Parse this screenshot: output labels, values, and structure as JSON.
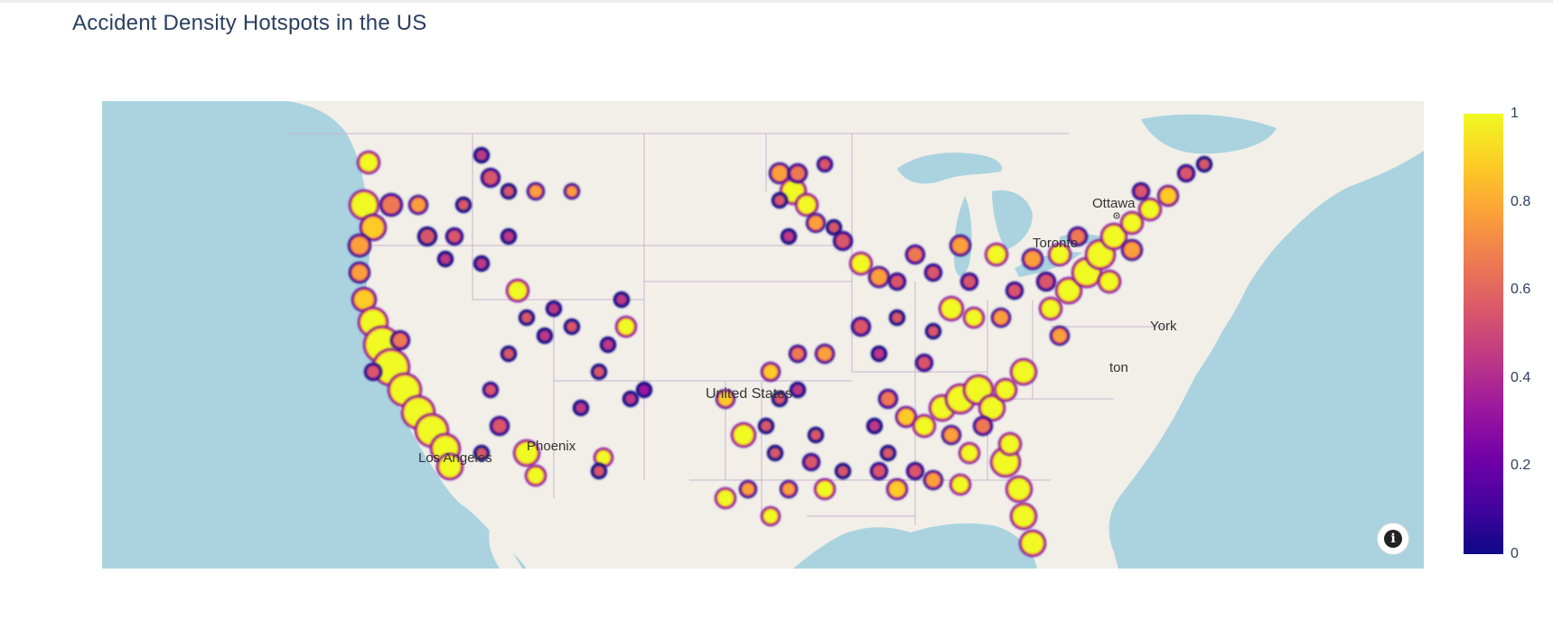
{
  "title": "Accident Density Hotspots in the US",
  "map": {
    "place_labels": {
      "ottawa": "Ottawa",
      "toronto": "Toronto",
      "new_york": "York",
      "washington": "ton",
      "united_states": "United States",
      "los_angeles": "Los Angeles",
      "phoenix": "Phoenix"
    },
    "colors": {
      "water": "#aad3df",
      "land": "#f2efe9",
      "border": "#c8b4c8"
    }
  },
  "colorbar": {
    "min": 0,
    "max": 1,
    "ticks": [
      "1",
      "0.8",
      "0.6",
      "0.4",
      "0.2",
      "0"
    ],
    "colorscale": [
      "#0d0887",
      "#46039f",
      "#7201a8",
      "#9c179e",
      "#bd3786",
      "#d8576b",
      "#ed7953",
      "#fb9f3a",
      "#fdca26",
      "#f0f921"
    ]
  },
  "info_button": {
    "icon": "info-icon"
  }
}
